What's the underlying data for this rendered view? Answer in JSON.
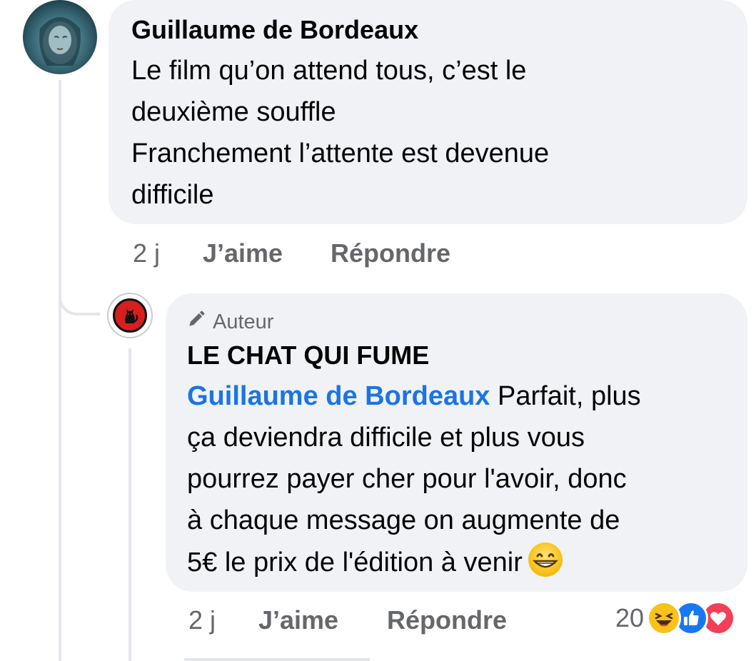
{
  "comment": {
    "author": "Guillaume de Bordeaux",
    "lines": [
      "Le film qu’on attend tous, c’est le",
      "deuxième souffle",
      "Franchement l’attente est devenue",
      "difficile"
    ],
    "time": "2 j",
    "like_label": "J’aime",
    "reply_label": "Répondre"
  },
  "reply": {
    "badge": "Auteur",
    "author": "LE CHAT QUI FUME",
    "mention": "Guillaume de Bordeaux",
    "line1_rest": " Parfait, plus",
    "lines": [
      "ça deviendra difficile et plus vous",
      "pourrez payer cher pour l'avoir, donc",
      "à chaque message on augmente de",
      "5€ le prix de l'édition à venir"
    ],
    "emoji": "grinning-face-emoji",
    "time": "2 j",
    "like_label": "J’aime",
    "reply_label": "Répondre",
    "reaction_count": "20",
    "reaction_icons": [
      "laughing-reaction-icon",
      "like-reaction-icon",
      "love-reaction-icon"
    ]
  },
  "colors": {
    "bubble": "#f0f2f5",
    "mention": "#1b74e4",
    "meta": "#65676b",
    "like_blue": "#1877f2",
    "love_red": "#f33e58"
  }
}
